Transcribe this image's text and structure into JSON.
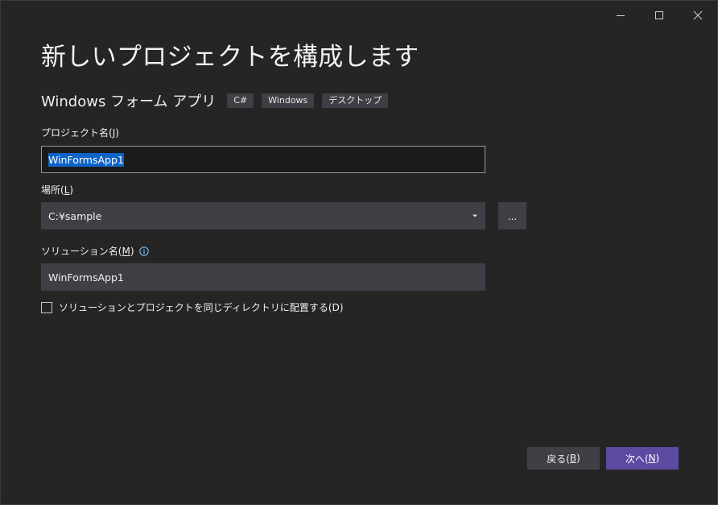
{
  "window": {
    "controls": {
      "minimize_icon": "minimize-icon",
      "maximize_icon": "maximize-icon",
      "close_icon": "close-icon"
    }
  },
  "header": {
    "title": "新しいプロジェクトを構成します"
  },
  "template": {
    "name": "Windows フォーム アプリ",
    "tags": [
      "C#",
      "Windows",
      "デスクトップ"
    ]
  },
  "form": {
    "project_name": {
      "label": "プロジェクト名(",
      "mnemonic": "J",
      "label_suffix": ")",
      "value": "WinFormsApp1"
    },
    "location": {
      "label": "場所(",
      "mnemonic": "L",
      "label_suffix": ")",
      "value": "C:¥sample",
      "browse_label": "..."
    },
    "solution_name": {
      "label": "ソリューション名(",
      "mnemonic": "M",
      "label_suffix": ")",
      "value": "WinFormsApp1",
      "info_icon": "info-icon"
    },
    "same_directory": {
      "label": "ソリューションとプロジェクトを同じディレクトリに配置する(",
      "mnemonic": "D",
      "label_suffix": ")",
      "checked": false
    }
  },
  "footer": {
    "back": {
      "label": "戻る(",
      "mnemonic": "B",
      "label_suffix": ")"
    },
    "next": {
      "label": "次へ(",
      "mnemonic": "N",
      "label_suffix": ")"
    }
  },
  "colors": {
    "background": "#252526",
    "input_background": "#3f3f46",
    "selection": "#0e63c8",
    "accent": "#5c4aa1",
    "info": "#75beff"
  }
}
